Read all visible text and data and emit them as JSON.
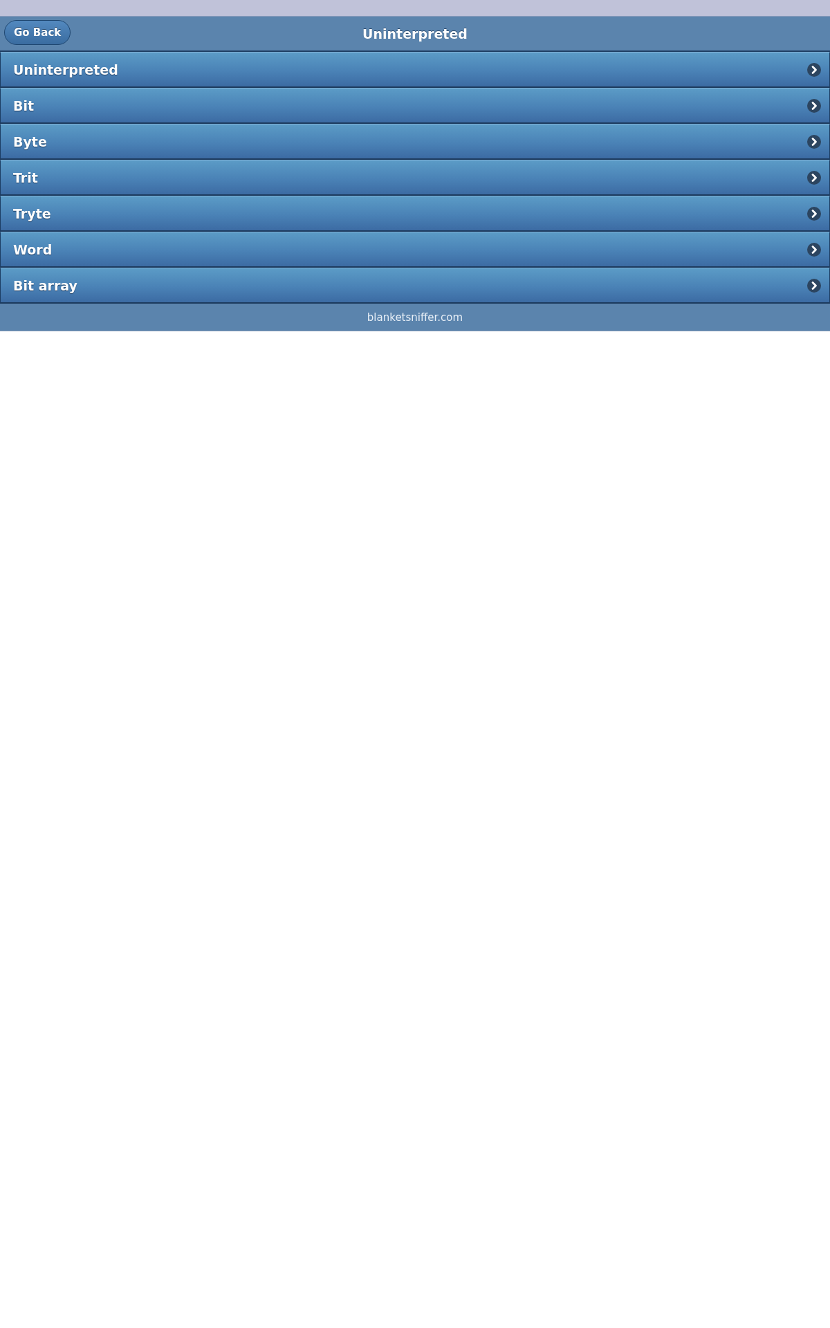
{
  "header": {
    "back_button": "Go Back",
    "title": "Uninterpreted"
  },
  "list": {
    "items": [
      {
        "label": "Uninterpreted"
      },
      {
        "label": "Bit"
      },
      {
        "label": "Byte"
      },
      {
        "label": "Trit"
      },
      {
        "label": "Tryte"
      },
      {
        "label": "Word"
      },
      {
        "label": "Bit array"
      }
    ]
  },
  "footer": {
    "text": "blanketsniffer.com"
  }
}
